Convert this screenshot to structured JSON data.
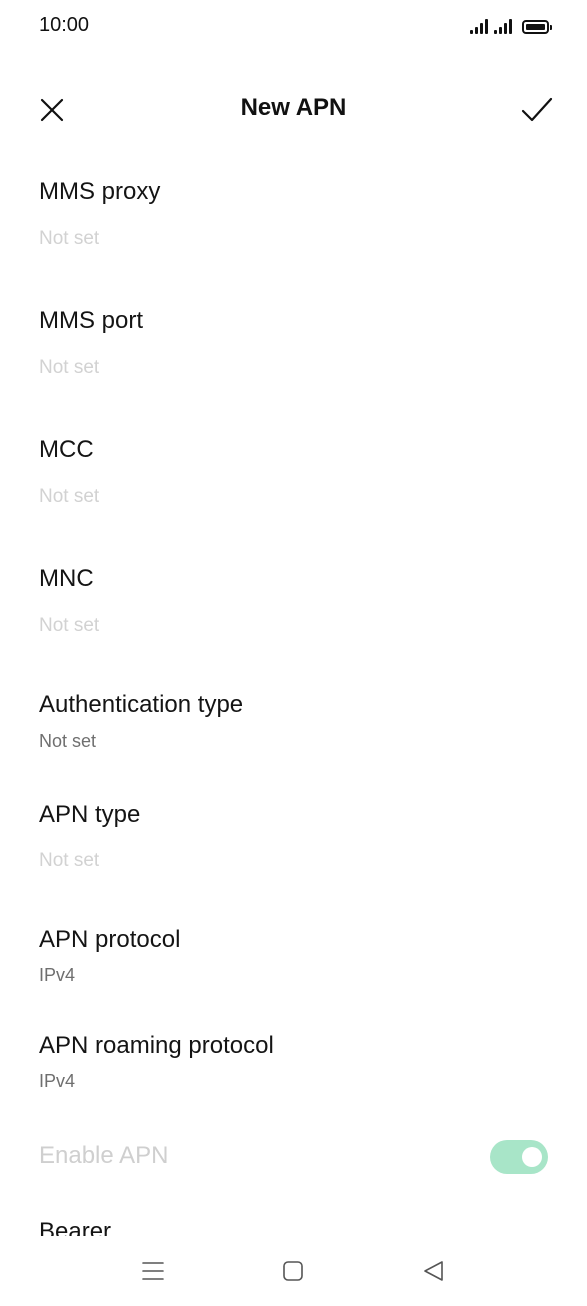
{
  "status_bar": {
    "time": "10:00",
    "icons": [
      "signal-icon",
      "signal-icon",
      "battery-icon"
    ]
  },
  "app_bar": {
    "title": "New APN",
    "close_icon": "close-icon",
    "confirm_icon": "check-icon"
  },
  "settings": [
    {
      "title": "MMS proxy",
      "value": "Not set"
    },
    {
      "title": "MMS port",
      "value": "Not set"
    },
    {
      "title": "MCC",
      "value": "Not set"
    },
    {
      "title": "MNC",
      "value": "Not set"
    },
    {
      "title": "Authentication type",
      "value": "Not set"
    },
    {
      "title": "APN type",
      "value": "Not set"
    },
    {
      "title": "APN protocol",
      "value": "IPv4"
    },
    {
      "title": "APN roaming protocol",
      "value": "IPv4"
    },
    {
      "title": "Enable APN",
      "toggle_on": true
    },
    {
      "title": "Bearer"
    }
  ],
  "colors": {
    "toggle_track": "#a8e5c8",
    "placeholder_text": "#d2d2d2",
    "secondary_text": "#6f6f6f"
  },
  "nav_bar": {
    "icons": [
      "menu-icon",
      "home-icon",
      "back-icon"
    ]
  }
}
